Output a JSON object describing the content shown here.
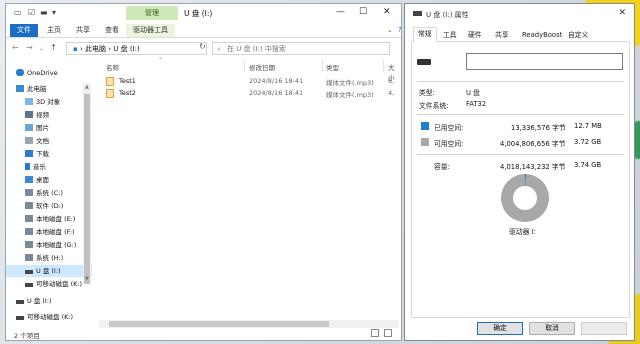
{
  "colors": {
    "accent": "#1a6fc4",
    "used": "#1f7fd1",
    "free": "#a8a8a8",
    "manage_tab": "#cde9b5"
  },
  "explorer": {
    "context_tab": "管理",
    "window_title": "U 盘 (I:)",
    "ribbon_tabs": [
      "文件",
      "主页",
      "共享",
      "查看",
      "驱动器工具"
    ],
    "address": {
      "path": [
        "此电脑",
        "U 盘 (I:)"
      ],
      "search_placeholder": "在 U 盘 (I:) 中搜索"
    },
    "sidebar": [
      {
        "label": "OneDrive",
        "icon": "cloud-icon"
      },
      {
        "label": "此电脑",
        "icon": "computer-icon"
      },
      {
        "label": "3D 对象",
        "icon": "cube-icon"
      },
      {
        "label": "视频",
        "icon": "video-icon"
      },
      {
        "label": "图片",
        "icon": "picture-icon"
      },
      {
        "label": "文档",
        "icon": "document-icon"
      },
      {
        "label": "下载",
        "icon": "download-icon"
      },
      {
        "label": "音乐",
        "icon": "music-icon"
      },
      {
        "label": "桌面",
        "icon": "desktop-icon"
      },
      {
        "label": "系统 (C:)",
        "icon": "drive-icon"
      },
      {
        "label": "软件 (D:)",
        "icon": "drive-icon"
      },
      {
        "label": "本地磁盘 (E:)",
        "icon": "drive-icon"
      },
      {
        "label": "本地磁盘 (F:)",
        "icon": "drive-icon"
      },
      {
        "label": "本地磁盘 (G:)",
        "icon": "drive-icon"
      },
      {
        "label": "系统 (H:)",
        "icon": "drive-icon"
      },
      {
        "label": "U 盘 (I:)",
        "icon": "usb-drive-icon",
        "selected": true
      },
      {
        "label": "可移动磁盘 (K:)",
        "icon": "usb-drive-icon"
      },
      {
        "label": "U 盘 (I:)",
        "icon": "usb-drive-icon"
      },
      {
        "label": "可移动磁盘 (K:)",
        "icon": "usb-drive-icon"
      }
    ],
    "columns": [
      "名称",
      "修改日期",
      "类型",
      "大小"
    ],
    "files": [
      {
        "name": "Test1",
        "date": "2024/8/16 18:41",
        "type": "媒体文件(.mp3)",
        "size": "6,"
      },
      {
        "name": "Test2",
        "date": "2024/8/16 18:41",
        "type": "媒体文件(.mp3)",
        "size": "4,"
      }
    ],
    "status": "2 个项目"
  },
  "dialog": {
    "title": "U 盘 (I:) 属性",
    "tabs": [
      "常规",
      "工具",
      "硬件",
      "共享",
      "ReadyBoost",
      "自定义"
    ],
    "name_value": "",
    "type_label": "类型:",
    "type_value": "U 盘",
    "fs_label": "文件系统:",
    "fs_value": "FAT32",
    "used_label": "已用空间:",
    "used_bytes": "13,336,576 字节",
    "used_h": "12.7 MB",
    "free_label": "可用空间:",
    "free_bytes": "4,004,806,656 字节",
    "free_h": "3.72 GB",
    "cap_label": "容量:",
    "cap_bytes": "4,018,143,232 字节",
    "cap_h": "3.74 GB",
    "used_fraction": 0.0033,
    "drive_label": "驱动器 I:",
    "ok": "确定",
    "cancel": "取消"
  }
}
